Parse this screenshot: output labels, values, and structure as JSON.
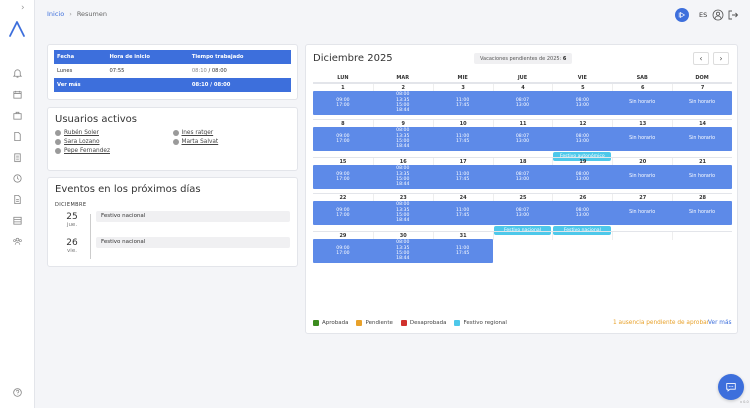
{
  "breadcrumb": {
    "home": "Inicio",
    "current": "Resumen"
  },
  "topbar": {
    "language": "ES"
  },
  "time_table": {
    "headers": [
      "Fecha",
      "Hora de inicio",
      "Tiempo trabajado"
    ],
    "row": {
      "day": "Lunes",
      "start": "07:55",
      "worked": "08:10",
      "expected": "/ 08:00"
    },
    "total": {
      "label": "Ver más",
      "value": "08:10 / 08:00"
    }
  },
  "users": {
    "title": "Usuarios activos",
    "list": [
      "Rubén Soler",
      "Ines ratger",
      "Sara Lozano",
      "Marta Salvat",
      "Pepe Fernandez"
    ]
  },
  "events": {
    "title": "Eventos en los próximos días",
    "month": "DICIEMBRE",
    "items": [
      {
        "day": "25",
        "dow": "jue.",
        "label": "Festivo nacional"
      },
      {
        "day": "26",
        "dow": "vie.",
        "label": "Festivo nacional"
      }
    ]
  },
  "calendar": {
    "title": "Diciembre 2025",
    "vacation_label": "Vacaciones pendientes de 2025:",
    "vacation_count": "6",
    "days_of_week": [
      "LUN",
      "MAR",
      "MIE",
      "JUE",
      "VIE",
      "SAB",
      "DOM"
    ],
    "no_schedule": "Sin horario",
    "weeks": [
      {
        "days": [
          "1",
          "2",
          "3",
          "4",
          "5",
          "6",
          "7"
        ]
      },
      {
        "days": [
          "8",
          "9",
          "10",
          "11",
          "12",
          "13",
          "14"
        ],
        "badge": {
          "label": "Festivo autonómico"
        }
      },
      {
        "days": [
          "15",
          "16",
          "17",
          "18",
          "19",
          "20",
          "21"
        ]
      },
      {
        "days": [
          "22",
          "23",
          "24",
          "25",
          "26",
          "27",
          "28"
        ],
        "badges": [
          {
            "label": "Festivo nacional"
          },
          {
            "label": "Festivo nacional"
          }
        ]
      },
      {
        "days": [
          "29",
          "30",
          "31"
        ]
      }
    ],
    "times": {
      "mon": [
        "09:00",
        "17:00"
      ],
      "tue": [
        "08:00",
        "13:35",
        "15:00",
        "18:44"
      ],
      "wed": [
        "11:00",
        "17:45"
      ],
      "thu": [
        "08:07",
        "13:00"
      ],
      "fri": [
        "08:00",
        "13:00"
      ]
    }
  },
  "legend": [
    {
      "label": "Aprobada",
      "color": "#3c8c1e"
    },
    {
      "label": "Pendiente",
      "color": "#e8a12a"
    },
    {
      "label": "Desaprobada",
      "color": "#d0312d"
    },
    {
      "label": "Festivo regional",
      "color": "#4ec8ea"
    }
  ],
  "pending_note": "1 ausencia pendiente de aprobar",
  "see_more": "Ver más",
  "colors": {
    "primary": "#3d6fdc",
    "calendar_bar": "#5d8ae8",
    "holiday": "#4ec8ea"
  },
  "version": "v 0.0"
}
